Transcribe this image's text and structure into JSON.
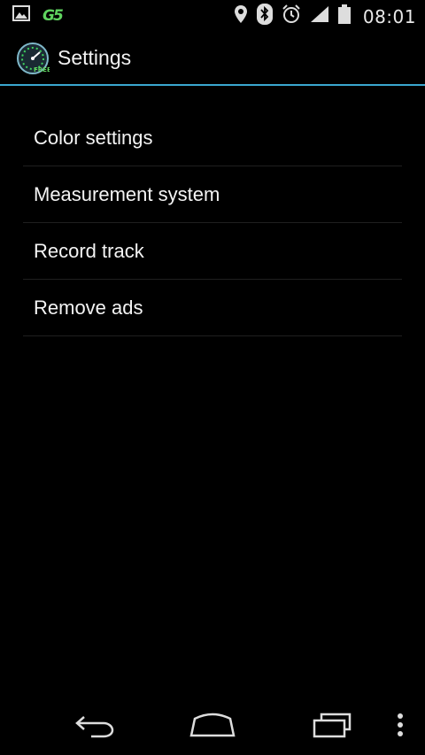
{
  "status_bar": {
    "time": "08:01",
    "left_icons": [
      "image-icon",
      "gs-app-icon"
    ],
    "gs_logo_text": "G5",
    "right_icons": [
      "location-icon",
      "bluetooth-icon",
      "alarm-icon",
      "signal-icon",
      "battery-icon"
    ]
  },
  "action_bar": {
    "title": "Settings",
    "app_icon": "speedometer-icon",
    "app_icon_badge": "FREE"
  },
  "settings": {
    "items": [
      {
        "label": "Color settings"
      },
      {
        "label": "Measurement system"
      },
      {
        "label": "Record track"
      },
      {
        "label": "Remove ads"
      }
    ]
  },
  "nav_bar": {
    "buttons": [
      "back-icon",
      "home-icon",
      "recent-apps-icon",
      "overflow-menu-icon"
    ]
  },
  "colors": {
    "background": "#000000",
    "accent_divider": "#3aa7cf",
    "text": "#f4f4f4",
    "gs_logo": "#5fd35f"
  }
}
